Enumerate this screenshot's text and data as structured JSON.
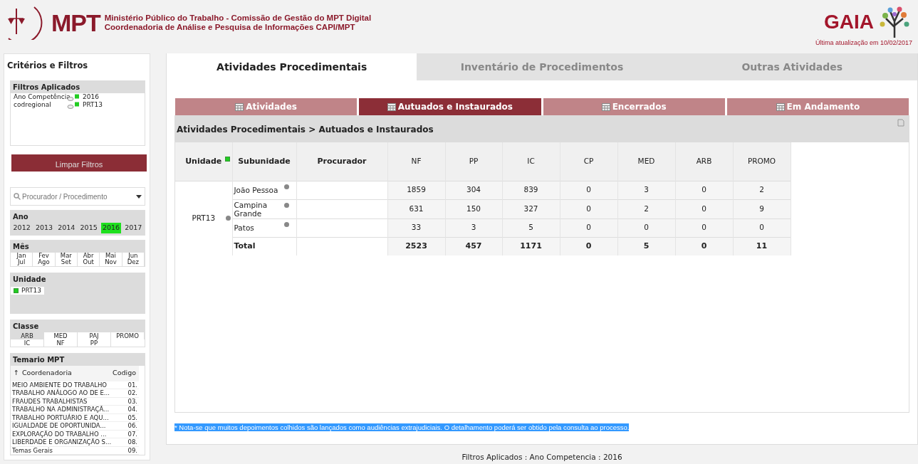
{
  "header": {
    "logo": "MPT",
    "title_lines": [
      "Ministério Público do Trabalho - Comissão de Gestão do MPT Digital",
      "Coordenadoria de Análise e Pesquisa de Informações CAPI/MPT"
    ],
    "brand": "GAIA",
    "last_update": "Última atualização em 10/02/2017"
  },
  "sidebar": {
    "title": "Critérios e Filtros",
    "applied_filters": {
      "title": "Filtros Aplicados",
      "items": [
        {
          "label": "Ano Competência",
          "value": "2016"
        },
        {
          "label": "codregional",
          "value": "PRT13"
        }
      ]
    },
    "clear_button": "Limpar Filtros",
    "search": {
      "placeholder": "Procurador / Procedimento"
    },
    "years": {
      "title": "Ano",
      "items": [
        {
          "label": "2012",
          "selected": false
        },
        {
          "label": "2013",
          "selected": false
        },
        {
          "label": "2014",
          "selected": false
        },
        {
          "label": "2015",
          "selected": false
        },
        {
          "label": "2016",
          "selected": true
        },
        {
          "label": "2017",
          "selected": false
        }
      ]
    },
    "months": {
      "title": "Mês",
      "items": [
        "Jan",
        "Fev",
        "Mar",
        "Abr",
        "Mai",
        "Jun",
        "Jul",
        "Ago",
        "Set",
        "Out",
        "Nov",
        "Dez"
      ]
    },
    "unidade": {
      "title": "Unidade",
      "items": [
        {
          "label": "PRT13",
          "checked": true
        }
      ]
    },
    "classe": {
      "title": "Classe",
      "items": [
        {
          "label": "ARB",
          "selected": true
        },
        {
          "label": "MED",
          "selected": false
        },
        {
          "label": "PAJ",
          "selected": false
        },
        {
          "label": "PROMO",
          "selected": false
        },
        {
          "label": "IC",
          "selected": false
        },
        {
          "label": "NF",
          "selected": false
        },
        {
          "label": "PP",
          "selected": false
        }
      ]
    },
    "temario": {
      "title": "Temario MPT",
      "sort_icon": "↑",
      "columns": [
        "Coordenadoria",
        "Codigo"
      ],
      "rows": [
        {
          "name": "MEIO AMBIENTE DO TRABALHO",
          "code": "01."
        },
        {
          "name": "TRABALHO ANÁLOGO AO DE E...",
          "code": "02."
        },
        {
          "name": "FRAUDES TRABALHISTAS",
          "code": "03."
        },
        {
          "name": "TRABALHO NA ADMINISTRAÇÃ...",
          "code": "04."
        },
        {
          "name": "TRABALHO PORTUÁRIO E AQU...",
          "code": "05."
        },
        {
          "name": "IGUALDADE DE OPORTUNIDA...",
          "code": "06."
        },
        {
          "name": "EXPLORAÇÃO DO TRABALHO ...",
          "code": "07."
        },
        {
          "name": "LIBERDADE E ORGANIZAÇÃO S...",
          "code": "08."
        },
        {
          "name": "Temas Gerais",
          "code": "09."
        }
      ]
    }
  },
  "tabs": [
    {
      "label": "Atividades Procedimentais",
      "selected": true
    },
    {
      "label": "Inventário de Procedimentos",
      "selected": false
    },
    {
      "label": "Outras Atividades",
      "selected": false
    }
  ],
  "subtabs": [
    {
      "label": "Atividades",
      "selected": false
    },
    {
      "label": "Autuados e Instaurados",
      "selected": true
    },
    {
      "label": "Encerrados",
      "selected": false
    },
    {
      "label": "Em Andamento",
      "selected": false
    }
  ],
  "breadcrumb": "Atividades Procedimentais > Autuados e Instaurados",
  "table": {
    "columns": [
      "Unidade",
      "Subunidade",
      "Procurador",
      "NF",
      "PP",
      "IC",
      "CP",
      "MED",
      "ARB",
      "PROMO"
    ],
    "unit": "PRT13",
    "rows": [
      {
        "subunidade": "João Pessoa",
        "values": [
          "1859",
          "304",
          "839",
          "0",
          "3",
          "0",
          "2"
        ]
      },
      {
        "subunidade": "Campina Grande",
        "values": [
          "631",
          "150",
          "327",
          "0",
          "2",
          "0",
          "9"
        ]
      },
      {
        "subunidade": "Patos",
        "values": [
          "33",
          "3",
          "5",
          "0",
          "0",
          "0",
          "0"
        ]
      }
    ],
    "total": {
      "label": "Total",
      "values": [
        "2523",
        "457",
        "1171",
        "0",
        "5",
        "0",
        "11"
      ]
    }
  },
  "note": "* Nota-se que muitos depoimentos colhidos são lançados como audiências extrajudiciais. O detalhamento poderá ser obtido pela consulta ao processo.",
  "footer": "Filtros Aplicados : Ano Competencia : 2016"
}
